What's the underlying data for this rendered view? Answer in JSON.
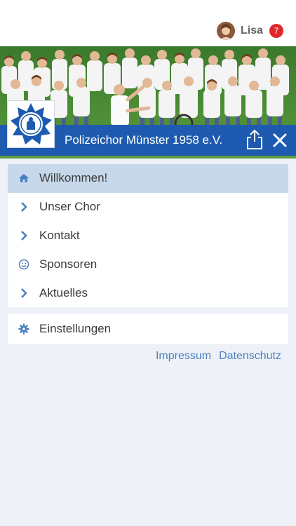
{
  "header": {
    "user_name": "Lisa",
    "notification_count": "7"
  },
  "banner": {
    "title": "Polizeichor Münster 1958 e.V."
  },
  "menu": {
    "items": [
      {
        "label": "Willkommen!",
        "icon": "home-icon",
        "active": true
      },
      {
        "label": "Unser Chor",
        "icon": "chevron-right-icon",
        "active": false
      },
      {
        "label": "Kontakt",
        "icon": "chevron-right-icon",
        "active": false
      },
      {
        "label": "Sponsoren",
        "icon": "smiley-icon",
        "active": false
      },
      {
        "label": "Aktuelles",
        "icon": "chevron-right-icon",
        "active": false
      }
    ],
    "settings_label": "Einstellungen"
  },
  "footer": {
    "impressum": "Impressum",
    "datenschutz": "Datenschutz"
  },
  "colors": {
    "accent": "#1e5bb0",
    "active_row": "#c7d8ea",
    "link": "#4a80c0",
    "icon": "#4a80c0",
    "badge": "#e0262b",
    "background": "#eef2f8"
  }
}
